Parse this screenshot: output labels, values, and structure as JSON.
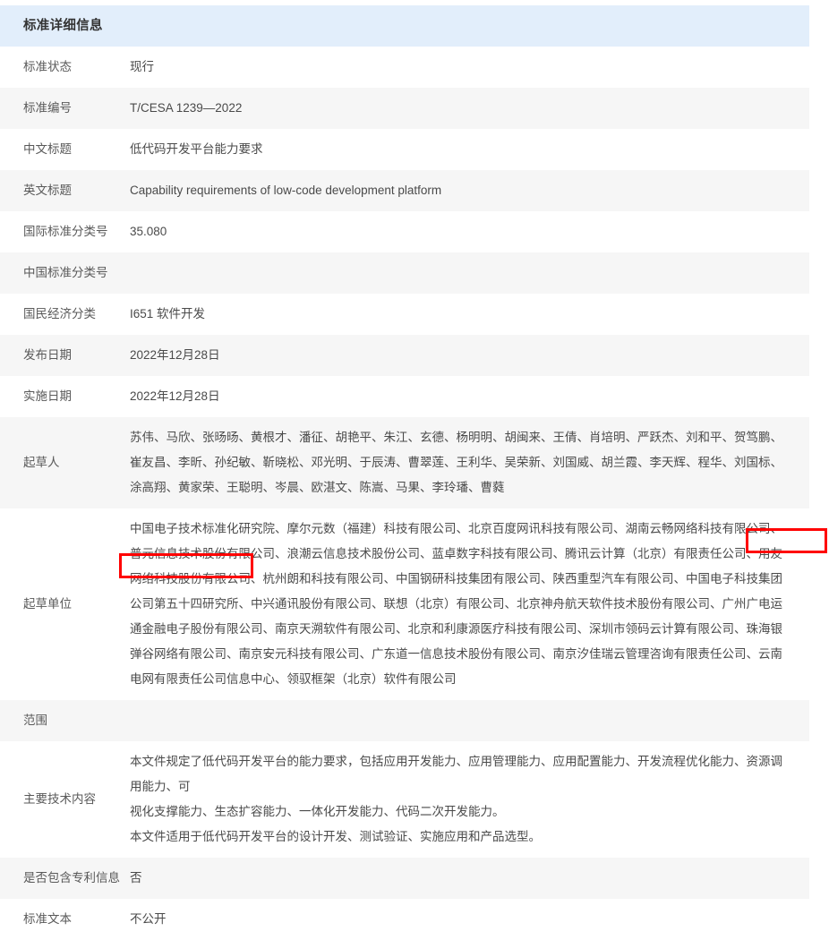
{
  "header": {
    "title": "标准详细信息"
  },
  "rows": [
    {
      "label": "标准状态",
      "value": "现行"
    },
    {
      "label": "标准编号",
      "value": "T/CESA 1239—2022"
    },
    {
      "label": "中文标题",
      "value": "低代码开发平台能力要求"
    },
    {
      "label": "英文标题",
      "value": "Capability requirements of low-code development platform"
    },
    {
      "label": "国际标准分类号",
      "value": "35.080"
    },
    {
      "label": "中国标准分类号",
      "value": ""
    },
    {
      "label": "国民经济分类",
      "value": "I651 软件开发"
    },
    {
      "label": "发布日期",
      "value": "2022年12月28日"
    },
    {
      "label": "实施日期",
      "value": "2022年12月28日"
    },
    {
      "label": "起草人",
      "value": "苏伟、马欣、张旸旸、黄根才、潘征、胡艳平、朱江、玄德、杨明明、胡闽来、王倩、肖培明、严跃杰、刘和平、贺笃鹏、崔友昌、李昕、孙纪敏、靳晓松、邓光明、于辰涛、曹翠莲、王利华、吴荣新、刘国威、胡兰霞、李天辉、程华、刘国标、涂高翔、黄家荣、王聪明、岑晨、欧湛文、陈嵩、马果、李玲璠、曹蕤"
    },
    {
      "label": "起草单位",
      "value": "中国电子技术标准化研究院、摩尔元数（福建）科技有限公司、北京百度网讯科技有限公司、湖南云畅网络科技有限公司、普元信息技术股份有限公司、浪潮云信息技术股份公司、蓝卓数字科技有限公司、腾讯云计算（北京）有限责任公司、用友网络科技股份有限公司、杭州朗和科技有限公司、中国钢研科技集团有限公司、陕西重型汽车有限公司、中国电子科技集团公司第五十四研究所、中兴通讯股份有限公司、联想（北京）有限公司、北京神舟航天软件技术股份有限公司、广州广电运通金融电子股份有限公司、南京天溯软件有限公司、北京和利康源医疗科技有限公司、深圳市领码云计算有限公司、珠海银弹谷网络有限公司、南京安元科技有限公司、广东道一信息技术股份有限公司、南京汐佳瑞云管理咨询有限责任公司、云南电网有限责任公司信息中心、领驭框架（北京）软件有限公司"
    },
    {
      "label": "范围",
      "value": ""
    },
    {
      "label": "是否包含专利信息",
      "value": "否"
    },
    {
      "label": "标准文本",
      "value": "不公开"
    }
  ],
  "main_content": {
    "label": "主要技术内容",
    "line1": "本文件规定了低代码开发平台的能力要求，包括应用开发能力、应用管理能力、应用配置能力、开发流程优化能力、资源调用能力、可",
    "line2": "视化支撑能力、生态扩容能力、一体化开发能力、代码二次开发能力。",
    "line3": "本文件适用于低代码开发平台的设计开发、测试验证、实施应用和产品选型。"
  },
  "highlights": [
    {
      "name": "guangdong-daoyi-part1",
      "text": "广东道一"
    },
    {
      "name": "guangdong-daoyi-part2",
      "text": "信息技术股份有限公司、"
    }
  ],
  "colors": {
    "header_bg": "#e2eefb",
    "row_alt_bg": "#f6f6f6",
    "row_bg": "#ffffff",
    "highlight_border": "#ff0000",
    "text": "#4a4a4a",
    "label_text": "#595959"
  }
}
